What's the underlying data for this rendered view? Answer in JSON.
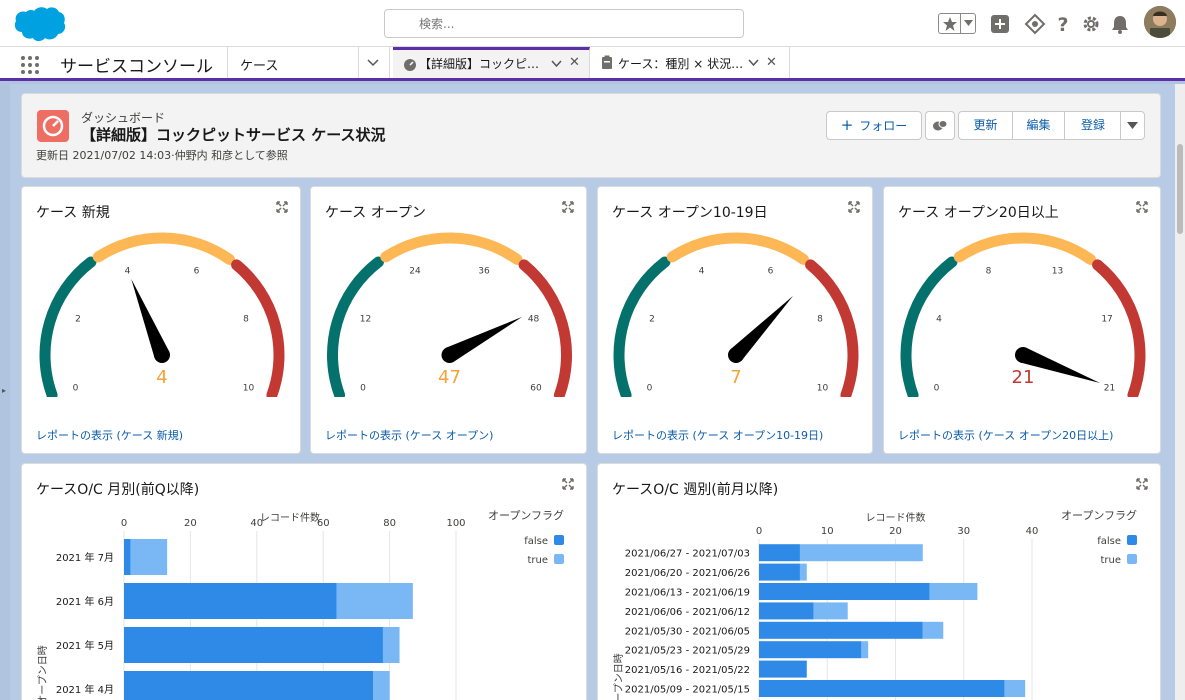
{
  "header": {
    "search_placeholder": "検索..."
  },
  "nav": {
    "app_name": "サービスコンソール",
    "object_select": "ケース",
    "tabs": [
      {
        "label": "【詳細版】コックピ…",
        "active": true
      },
      {
        "label": "ケース：種別 × 状況…",
        "active": false
      }
    ],
    "close_glyph": "✕"
  },
  "dashboard": {
    "type_label": "ダッシュボード",
    "title": "【詳細版】コックピットサービス ケース状況",
    "subtitle": "更新日 2021/07/02 14:03·仲野内 和彦として参照",
    "buttons": {
      "follow": "フォロー",
      "refresh": "更新",
      "edit": "編集",
      "subscribe": "登録"
    }
  },
  "gauges": [
    {
      "title": "ケース 新規",
      "ticks": [
        "0",
        "2",
        "4",
        "6",
        "8",
        "10"
      ],
      "value": 4,
      "value_label": "4",
      "min": 0,
      "max": 10,
      "value_color": "#f4a33b",
      "link": "レポートの表示 (ケース 新規)"
    },
    {
      "title": "ケース オープン",
      "ticks": [
        "0",
        "12",
        "24",
        "36",
        "48",
        "60"
      ],
      "value": 47,
      "value_label": "47",
      "min": 0,
      "max": 60,
      "value_color": "#f4a33b",
      "link": "レポートの表示 (ケース オープン)"
    },
    {
      "title": "ケース オープン10-19日",
      "ticks": [
        "0",
        "2",
        "4",
        "6",
        "8",
        "10"
      ],
      "value": 7,
      "value_label": "7",
      "min": 0,
      "max": 10,
      "value_color": "#f4a33b",
      "link": "レポートの表示 (ケース オープン10-19日)"
    },
    {
      "title": "ケース オープン20日以上",
      "ticks": [
        "0",
        "4",
        "8",
        "13",
        "17",
        "21"
      ],
      "value": 21,
      "value_label": "21",
      "min": 0,
      "max": 21,
      "value_color": "#c23934",
      "link": "レポートの表示 (ケース オープン20日以上)"
    }
  ],
  "colors": {
    "gauge_low": "#04716c",
    "gauge_mid": "#fdb755",
    "gauge_high": "#c23934",
    "bar_false": "#2e8ae6",
    "bar_true": "#7ab8f5"
  },
  "chart_data": [
    {
      "type": "bar",
      "orientation": "horizontal",
      "stacked": true,
      "title": "ケースO/C 月別(前Q以降)",
      "xlabel": "レコード件数",
      "ylabel": "オープン日時",
      "legend_title": "オープンフラグ",
      "legend_position": "right",
      "xlim": [
        0,
        100
      ],
      "xticks": [
        "0",
        "20",
        "40",
        "60",
        "80",
        "100"
      ],
      "categories": [
        "2021 年 7月",
        "2021 年 6月",
        "2021 年 5月",
        "2021 年 4月"
      ],
      "series": [
        {
          "name": "false",
          "values": [
            2,
            64,
            78,
            75
          ]
        },
        {
          "name": "true",
          "values": [
            11,
            23,
            5,
            5
          ]
        }
      ]
    },
    {
      "type": "bar",
      "orientation": "horizontal",
      "stacked": true,
      "title": "ケースO/C 週別(前月以降)",
      "xlabel": "レコード件数",
      "ylabel": "オープン日時",
      "legend_title": "オープンフラグ",
      "legend_position": "right",
      "xlim": [
        0,
        40
      ],
      "xticks": [
        "0",
        "10",
        "20",
        "30",
        "40"
      ],
      "categories": [
        "2021/06/27 - 2021/07/03",
        "2021/06/20 - 2021/06/26",
        "2021/06/13 - 2021/06/19",
        "2021/06/06 - 2021/06/12",
        "2021/05/30 - 2021/06/05",
        "2021/05/23 - 2021/05/29",
        "2021/05/16 - 2021/05/22",
        "2021/05/09 - 2021/05/15"
      ],
      "series": [
        {
          "name": "false",
          "values": [
            6,
            6,
            25,
            8,
            24,
            15,
            7,
            36
          ]
        },
        {
          "name": "true",
          "values": [
            18,
            1,
            7,
            5,
            3,
            1,
            0,
            3
          ]
        }
      ]
    }
  ]
}
